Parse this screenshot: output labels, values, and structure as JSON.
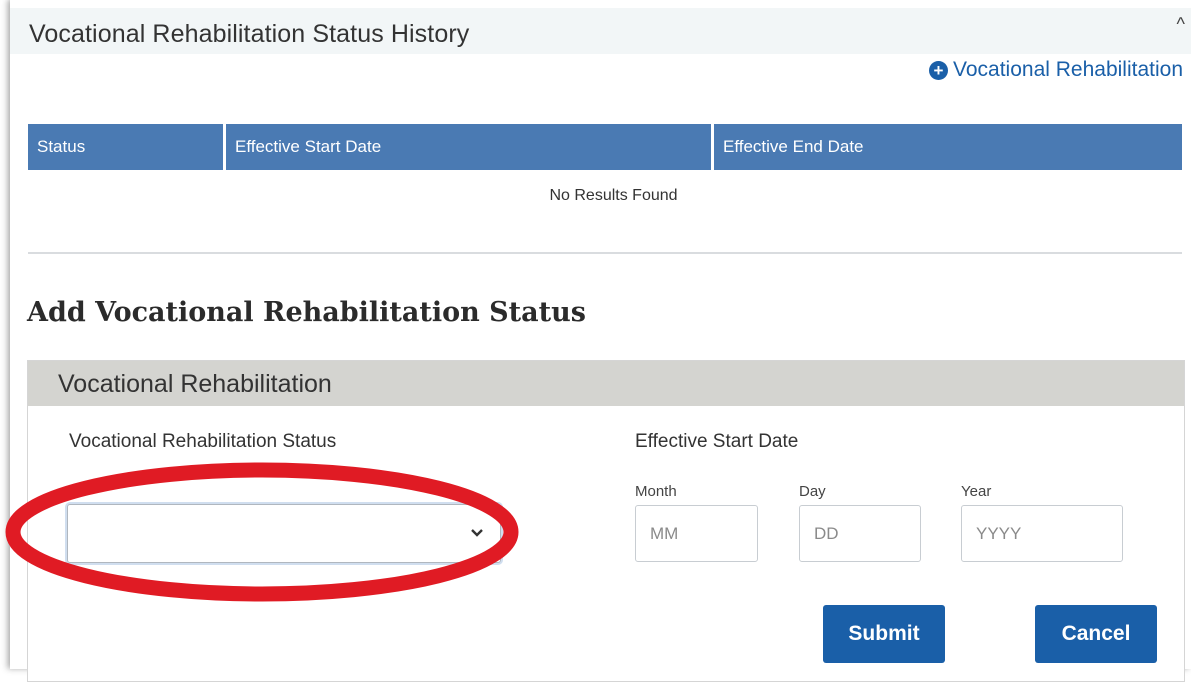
{
  "section": {
    "title": "Vocational Rehabilitation Status History",
    "collapse_icon": "^",
    "add_link_label": "Vocational Rehabilitation"
  },
  "table": {
    "columns": [
      "Status",
      "Effective Start Date",
      "Effective End Date"
    ],
    "empty_message": "No Results Found"
  },
  "form": {
    "heading": "Add Vocational Rehabilitation Status",
    "card_title": "Vocational Rehabilitation",
    "status_label": "Vocational Rehabilitation Status",
    "status_value": "",
    "start_date_label": "Effective Start Date",
    "month_label": "Month",
    "day_label": "Day",
    "year_label": "Year",
    "month_placeholder": "MM",
    "day_placeholder": "DD",
    "year_placeholder": "YYYY",
    "submit_label": "Submit",
    "cancel_label": "Cancel"
  },
  "colors": {
    "table_header": "#4a7ab3",
    "button": "#1a5fa8",
    "link": "#1a5fa8",
    "highlight_annotation": "#e01b24"
  },
  "icons": {
    "add": "plus-circle-icon",
    "collapse": "chevron-up-icon",
    "dropdown": "chevron-down-icon"
  }
}
